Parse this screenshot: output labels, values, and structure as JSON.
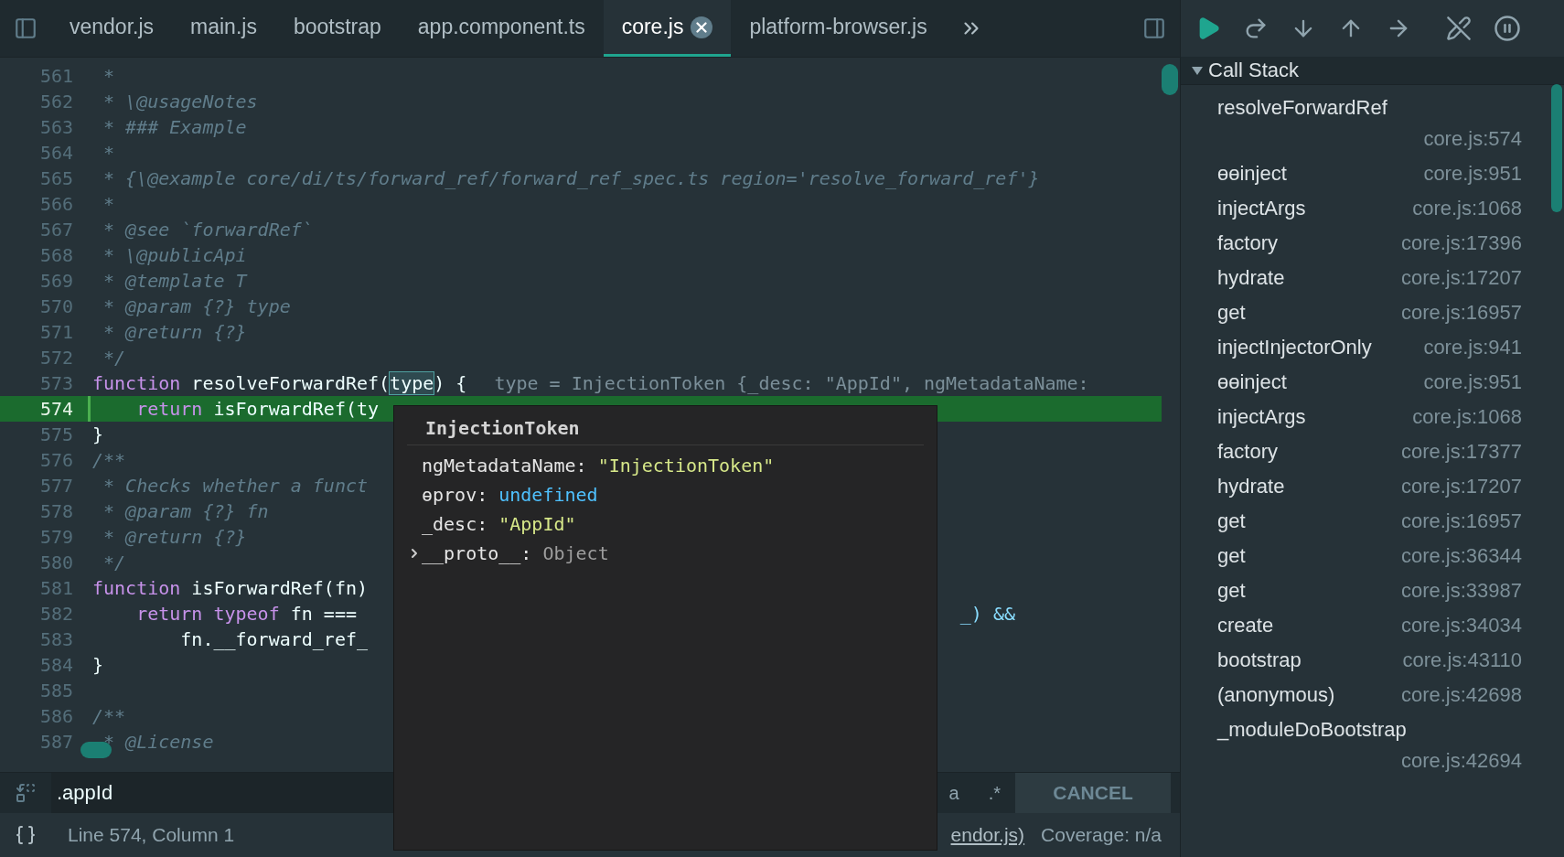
{
  "tabs": [
    {
      "label": "vendor.js",
      "selected": false
    },
    {
      "label": "main.js",
      "selected": false
    },
    {
      "label": "bootstrap",
      "selected": false
    },
    {
      "label": "app.component.ts",
      "selected": false
    },
    {
      "label": "core.js",
      "selected": true
    },
    {
      "label": "platform-browser.js",
      "selected": false
    }
  ],
  "code_lines": [
    {
      "number": "561",
      "current": false,
      "segments": [
        {
          "kind": "comment",
          "text": " *"
        }
      ]
    },
    {
      "number": "562",
      "current": false,
      "segments": [
        {
          "kind": "comment",
          "text": " * \\@usageNotes"
        }
      ]
    },
    {
      "number": "563",
      "current": false,
      "segments": [
        {
          "kind": "comment",
          "text": " * ### Example"
        }
      ]
    },
    {
      "number": "564",
      "current": false,
      "segments": [
        {
          "kind": "comment",
          "text": " *"
        }
      ]
    },
    {
      "number": "565",
      "current": false,
      "segments": [
        {
          "kind": "comment",
          "text": " * {\\@example core/di/ts/forward_ref/forward_ref_spec.ts region='resolve_forward_ref'}"
        }
      ]
    },
    {
      "number": "566",
      "current": false,
      "segments": [
        {
          "kind": "comment",
          "text": " *"
        }
      ]
    },
    {
      "number": "567",
      "current": false,
      "segments": [
        {
          "kind": "comment",
          "text": " * @see `forwardRef`"
        }
      ]
    },
    {
      "number": "568",
      "current": false,
      "segments": [
        {
          "kind": "comment",
          "text": " * \\@publicApi"
        }
      ]
    },
    {
      "number": "569",
      "current": false,
      "segments": [
        {
          "kind": "comment",
          "text": " * @template T"
        }
      ]
    },
    {
      "number": "570",
      "current": false,
      "segments": [
        {
          "kind": "comment",
          "text": " * @param {?} type"
        }
      ]
    },
    {
      "number": "571",
      "current": false,
      "segments": [
        {
          "kind": "comment",
          "text": " * @return {?}"
        }
      ]
    },
    {
      "number": "572",
      "current": false,
      "segments": [
        {
          "kind": "comment",
          "text": " */"
        }
      ]
    },
    {
      "number": "573",
      "current": false,
      "segments": [
        {
          "kind": "keyword",
          "text": "function"
        },
        {
          "kind": "plain",
          "text": " resolveForwardRef("
        },
        {
          "kind": "hover",
          "text": "type"
        },
        {
          "kind": "plain",
          "text": ") {"
        },
        {
          "kind": "inline",
          "text": "type = InjectionToken {_desc: \"AppId\", ngMetadataName:"
        }
      ]
    },
    {
      "number": "574",
      "current": true,
      "segments": [
        {
          "kind": "keyword",
          "text": "    return"
        },
        {
          "kind": "plain",
          "text": " isForwardRef(ty"
        }
      ]
    },
    {
      "number": "575",
      "current": false,
      "segments": [
        {
          "kind": "plain",
          "text": "}"
        }
      ]
    },
    {
      "number": "576",
      "current": false,
      "segments": [
        {
          "kind": "comment",
          "text": "/**"
        }
      ]
    },
    {
      "number": "577",
      "current": false,
      "segments": [
        {
          "kind": "comment",
          "text": " * Checks whether a funct"
        }
      ]
    },
    {
      "number": "578",
      "current": false,
      "segments": [
        {
          "kind": "comment",
          "text": " * @param {?} fn"
        }
      ]
    },
    {
      "number": "579",
      "current": false,
      "segments": [
        {
          "kind": "comment",
          "text": " * @return {?}"
        }
      ]
    },
    {
      "number": "580",
      "current": false,
      "segments": [
        {
          "kind": "comment",
          "text": " */"
        }
      ]
    },
    {
      "number": "581",
      "current": false,
      "segments": [
        {
          "kind": "keyword",
          "text": "function"
        },
        {
          "kind": "plain",
          "text": " isForwardRef(fn)"
        }
      ]
    },
    {
      "number": "582",
      "current": false,
      "segments": [
        {
          "kind": "keyword",
          "text": "    return typeof"
        },
        {
          "kind": "plain",
          "text": " fn ==="
        },
        {
          "kind": "right",
          "text": "_) &&"
        }
      ]
    },
    {
      "number": "583",
      "current": false,
      "segments": [
        {
          "kind": "plain",
          "text": "        fn.__forward_ref_"
        }
      ]
    },
    {
      "number": "584",
      "current": false,
      "segments": [
        {
          "kind": "plain",
          "text": "}"
        }
      ]
    },
    {
      "number": "585",
      "current": false
    },
    {
      "number": "586",
      "current": false,
      "segments": [
        {
          "kind": "comment",
          "text": "/**"
        }
      ]
    },
    {
      "number": "587",
      "current": false,
      "segments": [
        {
          "kind": "comment",
          "text": " * @License"
        }
      ]
    }
  ],
  "popup": {
    "title": "InjectionToken",
    "properties": [
      {
        "name": "ngMetadataName:",
        "value": "\"InjectionToken\"",
        "kind": "string",
        "expandable": false
      },
      {
        "name": "ɵprov:",
        "value": "undefined",
        "kind": "undefined",
        "expandable": false
      },
      {
        "name": "_desc:",
        "value": "\"AppId\"",
        "kind": "string",
        "expandable": false
      },
      {
        "name": "__proto__:",
        "value": "Object",
        "kind": "object",
        "expandable": true
      }
    ]
  },
  "search": {
    "value": ".appId",
    "option_1": "a",
    "option_2": ".*",
    "cancel": "CANCEL"
  },
  "status_bar": {
    "position": "Line 574, Column 1",
    "source": "endor.js)",
    "coverage": "Coverage: n/a"
  },
  "call_stack": {
    "title": "Call Stack",
    "expanded": true,
    "frames": [
      {
        "name": "resolveForwardRef",
        "location": "core.js:574",
        "wrapped": true
      },
      {
        "name": "ɵɵinject",
        "location": "core.js:951",
        "wrapped": false
      },
      {
        "name": "injectArgs",
        "location": "core.js:1068",
        "wrapped": false
      },
      {
        "name": "factory",
        "location": "core.js:17396",
        "wrapped": false
      },
      {
        "name": "hydrate",
        "location": "core.js:17207",
        "wrapped": false
      },
      {
        "name": "get",
        "location": "core.js:16957",
        "wrapped": false
      },
      {
        "name": "injectInjectorOnly",
        "location": "core.js:941",
        "wrapped": false
      },
      {
        "name": "ɵɵinject",
        "location": "core.js:951",
        "wrapped": false
      },
      {
        "name": "injectArgs",
        "location": "core.js:1068",
        "wrapped": false
      },
      {
        "name": "factory",
        "location": "core.js:17377",
        "wrapped": false
      },
      {
        "name": "hydrate",
        "location": "core.js:17207",
        "wrapped": false
      },
      {
        "name": "get",
        "location": "core.js:16957",
        "wrapped": false
      },
      {
        "name": "get",
        "location": "core.js:36344",
        "wrapped": false
      },
      {
        "name": "get",
        "location": "core.js:33987",
        "wrapped": false
      },
      {
        "name": "create",
        "location": "core.js:34034",
        "wrapped": false
      },
      {
        "name": "bootstrap",
        "location": "core.js:43110",
        "wrapped": false
      },
      {
        "name": "(anonymous)",
        "location": "core.js:42698",
        "wrapped": false
      },
      {
        "name": "_moduleDoBootstrap",
        "location": "core.js:42694",
        "wrapped": true
      }
    ]
  }
}
